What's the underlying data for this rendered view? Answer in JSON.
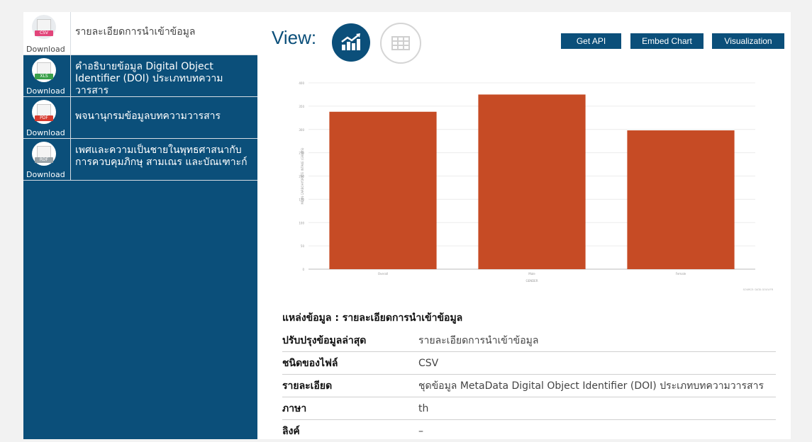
{
  "sidebar": {
    "download_label": "Download",
    "items": [
      {
        "title": "รายละเอียดการนำเข้าข้อมูล",
        "format": "CSV",
        "badge_color": "#e2457a"
      },
      {
        "title": "คำอธิบายข้อมูล Digital Object Identifier (DOI) ประเภทบทความวารสาร",
        "format": "XLS",
        "badge_color": "#3aa04a"
      },
      {
        "title": "พจนานุกรมข้อมูลบทความวารสาร",
        "format": "PDF",
        "badge_color": "#d63a2f"
      },
      {
        "title": "เพศและความเป็นชายในพุทธศาสนากับการควบคุมภิกษุ สามเณร และบัณเฑาะก์",
        "format": "RDF",
        "badge_color": "#9aa3a8"
      }
    ]
  },
  "header": {
    "view_label": "View:",
    "chart_view_icon": "chart-trend-icon",
    "table_view_icon": "table-grid-icon",
    "buttons": [
      "Get API",
      "Embed Chart",
      "Visualization"
    ]
  },
  "chart_data": {
    "type": "bar",
    "categories": [
      "Overall",
      "Male",
      "Female"
    ],
    "values": [
      338,
      375,
      298
    ],
    "xlabel": "GENDER",
    "ylabel": "MEAN CARBOHYDRATE INTAKE (GRAMS)",
    "ylim": [
      0,
      400
    ],
    "yticks": [
      0,
      50,
      100,
      150,
      200,
      250,
      300,
      350,
      400
    ],
    "bar_color": "#c64b25",
    "grid": true,
    "watermark": "SOURCE: DATA GOUV.FR"
  },
  "info": {
    "source_label": "แหล่งข้อมูล : รายละเอียดการนำเข้าข้อมูล",
    "rows": [
      {
        "key": "ปรับปรุงข้อมูลล่าสุด",
        "value": "รายละเอียดการนำเข้าข้อมูล"
      },
      {
        "key": "ชนิดของไฟล์",
        "value": "CSV"
      },
      {
        "key": "รายละเอียด",
        "value": "ชุดข้อมูล MetaData Digital Object Identifier (DOI) ประเภทบทความวารสาร"
      },
      {
        "key": "ภาษา",
        "value": "th"
      },
      {
        "key": "ลิงค์",
        "value": "–"
      }
    ]
  }
}
